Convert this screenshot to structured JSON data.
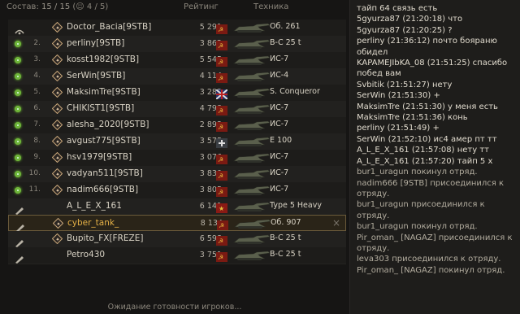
{
  "header": {
    "composition_label": "Состав:",
    "composition_total": "15 / 15",
    "composition_ready": "4 / 5",
    "rating_header": "Рейтинг",
    "vehicle_header": "Техника"
  },
  "players": [
    {
      "index": "",
      "status": "none",
      "name": "Doctor_Bacia[9STB]",
      "rating": "5 291",
      "nation": "ussr",
      "vehicle": "Об. 261",
      "commander": true
    },
    {
      "index": "2.",
      "status": "ready",
      "name": "perliny[9STB]",
      "rating": "3 862",
      "nation": "ussr",
      "vehicle": "B-C 25 t"
    },
    {
      "index": "3.",
      "status": "ready",
      "name": "kosst1982[9STB]",
      "rating": "5 545",
      "nation": "ussr",
      "vehicle": "ИС-7"
    },
    {
      "index": "4.",
      "status": "ready",
      "name": "SerWin[9STB]",
      "rating": "4 114",
      "nation": "ussr",
      "vehicle": "ИС-4"
    },
    {
      "index": "5.",
      "status": "ready",
      "name": "MaksimTre[9STB]",
      "rating": "3 282",
      "nation": "uk",
      "vehicle": "S. Conqueror"
    },
    {
      "index": "6.",
      "status": "ready",
      "name": "CHIKIST1[9STB]",
      "rating": "4 798",
      "nation": "ussr",
      "vehicle": "ИС-7"
    },
    {
      "index": "7.",
      "status": "ready",
      "name": "alesha_2020[9STB]",
      "rating": "2 893",
      "nation": "ussr",
      "vehicle": "ИС-7"
    },
    {
      "index": "8.",
      "status": "ready",
      "name": "avgust775[9STB]",
      "rating": "3 575",
      "nation": "germany",
      "vehicle": "E 100"
    },
    {
      "index": "9.",
      "status": "ready",
      "name": "hsv1979[9STB]",
      "rating": "3 076",
      "nation": "ussr",
      "vehicle": "ИС-7"
    },
    {
      "index": "10.",
      "status": "ready",
      "name": "vadyan511[9STB]",
      "rating": "3 830",
      "nation": "ussr",
      "vehicle": "ИС-7"
    },
    {
      "index": "11.",
      "status": "ready",
      "name": "nadim666[9STB]",
      "rating": "3 805",
      "nation": "ussr",
      "vehicle": "ИС-7"
    },
    {
      "index": "",
      "status": "ready",
      "name": "A_L_E_X_161",
      "rating": "6 141",
      "nation": "china",
      "vehicle": "Type 5 Heavy",
      "legionary": true
    },
    {
      "index": "",
      "status": "ready",
      "name": "cyber_tank_",
      "rating": "8 134",
      "nation": "ussr",
      "vehicle": "Об. 907",
      "legionary": true,
      "selected": true,
      "close_label": "×"
    },
    {
      "index": "",
      "status": "none",
      "name": "Bupito_FX[FREZE]",
      "rating": "6 598",
      "nation": "ussr",
      "vehicle": "B-C 25 t",
      "legionary": true
    },
    {
      "index": "",
      "status": "ready",
      "name": "Petro430",
      "rating": "3 751",
      "nation": "ussr",
      "vehicle": "B-C 25 t",
      "legionary": true
    }
  ],
  "waiting_text": "Ожидание готовности игроков...",
  "chat": [
    {
      "t": "тайп 64 связь есть",
      "sys": false
    },
    {
      "t": "5gyurza87 (21:20:18) что",
      "sys": false
    },
    {
      "t": "5gyurza87 (21:20:25) ?",
      "sys": false
    },
    {
      "t": "perliny (21:36:12) почто бояраню",
      "sys": false
    },
    {
      "t": "обидел",
      "sys": false
    },
    {
      "t": "KAPAMEJIbKA_08 (21:51:25) спасибо",
      "sys": false
    },
    {
      "t": "побед вам",
      "sys": false
    },
    {
      "t": "Svbitik (21:51:27) нету",
      "sys": false
    },
    {
      "t": "SerWin (21:51:30) +",
      "sys": false
    },
    {
      "t": "MaksimTre (21:51:30) у меня есть",
      "sys": false
    },
    {
      "t": "MaksimTre (21:51:36) конь",
      "sys": false
    },
    {
      "t": "perliny (21:51:49) +",
      "sys": false
    },
    {
      "t": "SerWin (21:52:10) ис4 амер пт тт",
      "sys": false
    },
    {
      "t": "A_L_E_X_161 (21:57:08) нету тт",
      "sys": false
    },
    {
      "t": "A_L_E_X_161 (21:57:20) тайп 5 х",
      "sys": false
    },
    {
      "t": "bur1_uragun покинул отряд.",
      "sys": true
    },
    {
      "t": "nadim666 [9STB] присоединился к",
      "sys": true
    },
    {
      "t": "отряду.",
      "sys": true
    },
    {
      "t": "bur1_uragun присоединился к",
      "sys": true
    },
    {
      "t": "отряду.",
      "sys": true
    },
    {
      "t": "bur1_uragun покинул отряд.",
      "sys": true
    },
    {
      "t": "Pir_oman_ [NAGAZ] присоединился к",
      "sys": true
    },
    {
      "t": "отряду.",
      "sys": true
    },
    {
      "t": "leva303 присоединился к отряду.",
      "sys": true
    },
    {
      "t": "Pir_oman_ [NAGAZ] покинул отряд.",
      "sys": true
    }
  ]
}
